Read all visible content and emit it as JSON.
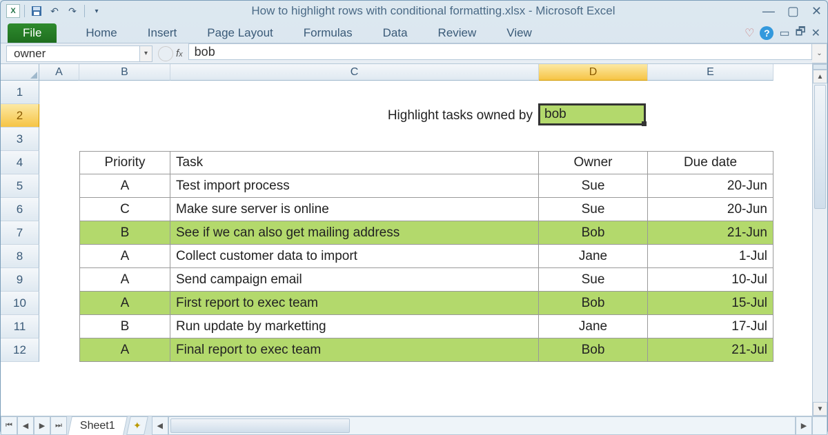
{
  "window": {
    "title": "How to highlight rows with conditional formatting.xlsx - Microsoft Excel"
  },
  "ribbon": {
    "file": "File",
    "tabs": [
      "Home",
      "Insert",
      "Page Layout",
      "Formulas",
      "Data",
      "Review",
      "View"
    ]
  },
  "nameBox": "owner",
  "formulaBar": "bob",
  "columns": [
    "A",
    "B",
    "C",
    "D",
    "E"
  ],
  "rowNumbers": [
    "1",
    "2",
    "3",
    "4",
    "5",
    "6",
    "7",
    "8",
    "9",
    "10",
    "11",
    "12"
  ],
  "selected": {
    "col": "D",
    "row": "2"
  },
  "sheet": {
    "promptLabel": "Highlight tasks owned by",
    "activeCellValue": "bob",
    "headers": {
      "priority": "Priority",
      "task": "Task",
      "owner": "Owner",
      "due": "Due date"
    },
    "rows": [
      {
        "priority": "A",
        "task": "Test import process",
        "owner": "Sue",
        "due": "20-Jun",
        "hl": false
      },
      {
        "priority": "C",
        "task": "Make sure server is online",
        "owner": "Sue",
        "due": "20-Jun",
        "hl": false
      },
      {
        "priority": "B",
        "task": "See if we can also get mailing address",
        "owner": "Bob",
        "due": "21-Jun",
        "hl": true
      },
      {
        "priority": "A",
        "task": "Collect customer data to import",
        "owner": "Jane",
        "due": "1-Jul",
        "hl": false
      },
      {
        "priority": "A",
        "task": "Send campaign email",
        "owner": "Sue",
        "due": "10-Jul",
        "hl": false
      },
      {
        "priority": "A",
        "task": "First report to exec team",
        "owner": "Bob",
        "due": "15-Jul",
        "hl": true
      },
      {
        "priority": "B",
        "task": "Run update by marketting",
        "owner": "Jane",
        "due": "17-Jul",
        "hl": false
      },
      {
        "priority": "A",
        "task": "Final report to exec team",
        "owner": "Bob",
        "due": "21-Jul",
        "hl": true
      }
    ]
  },
  "sheetTab": "Sheet1"
}
